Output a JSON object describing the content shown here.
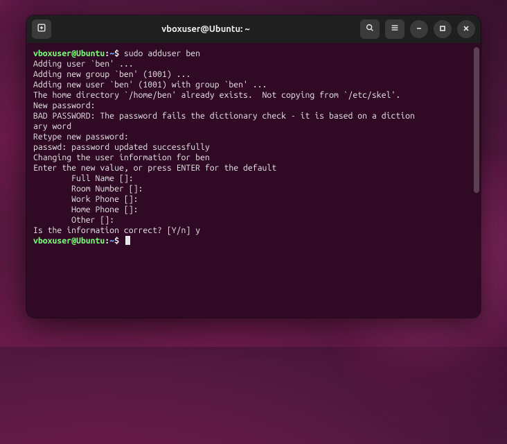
{
  "window": {
    "title": "vboxuser@Ubuntu: ~"
  },
  "prompt": {
    "user_host": "vboxuser@Ubuntu",
    "separator": ":",
    "path": "~",
    "symbol": "$"
  },
  "session": {
    "command1": "sudo adduser ben",
    "lines": [
      "Adding user `ben' ...",
      "Adding new group `ben' (1001) ...",
      "Adding new user `ben' (1001) with group `ben' ...",
      "The home directory `/home/ben' already exists.  Not copying from `/etc/skel'.",
      "New password:",
      "BAD PASSWORD: The password fails the dictionary check - it is based on a diction",
      "ary word",
      "Retype new password:",
      "passwd: password updated successfully",
      "Changing the user information for ben",
      "Enter the new value, or press ENTER for the default",
      "        Full Name []:",
      "        Room Number []:",
      "        Work Phone []:",
      "        Home Phone []:",
      "        Other []:",
      "Is the information correct? [Y/n] y"
    ]
  },
  "icons": {
    "new_tab": "new-tab",
    "search": "search",
    "menu": "menu",
    "minimize": "minimize",
    "maximize": "maximize",
    "close": "close"
  }
}
